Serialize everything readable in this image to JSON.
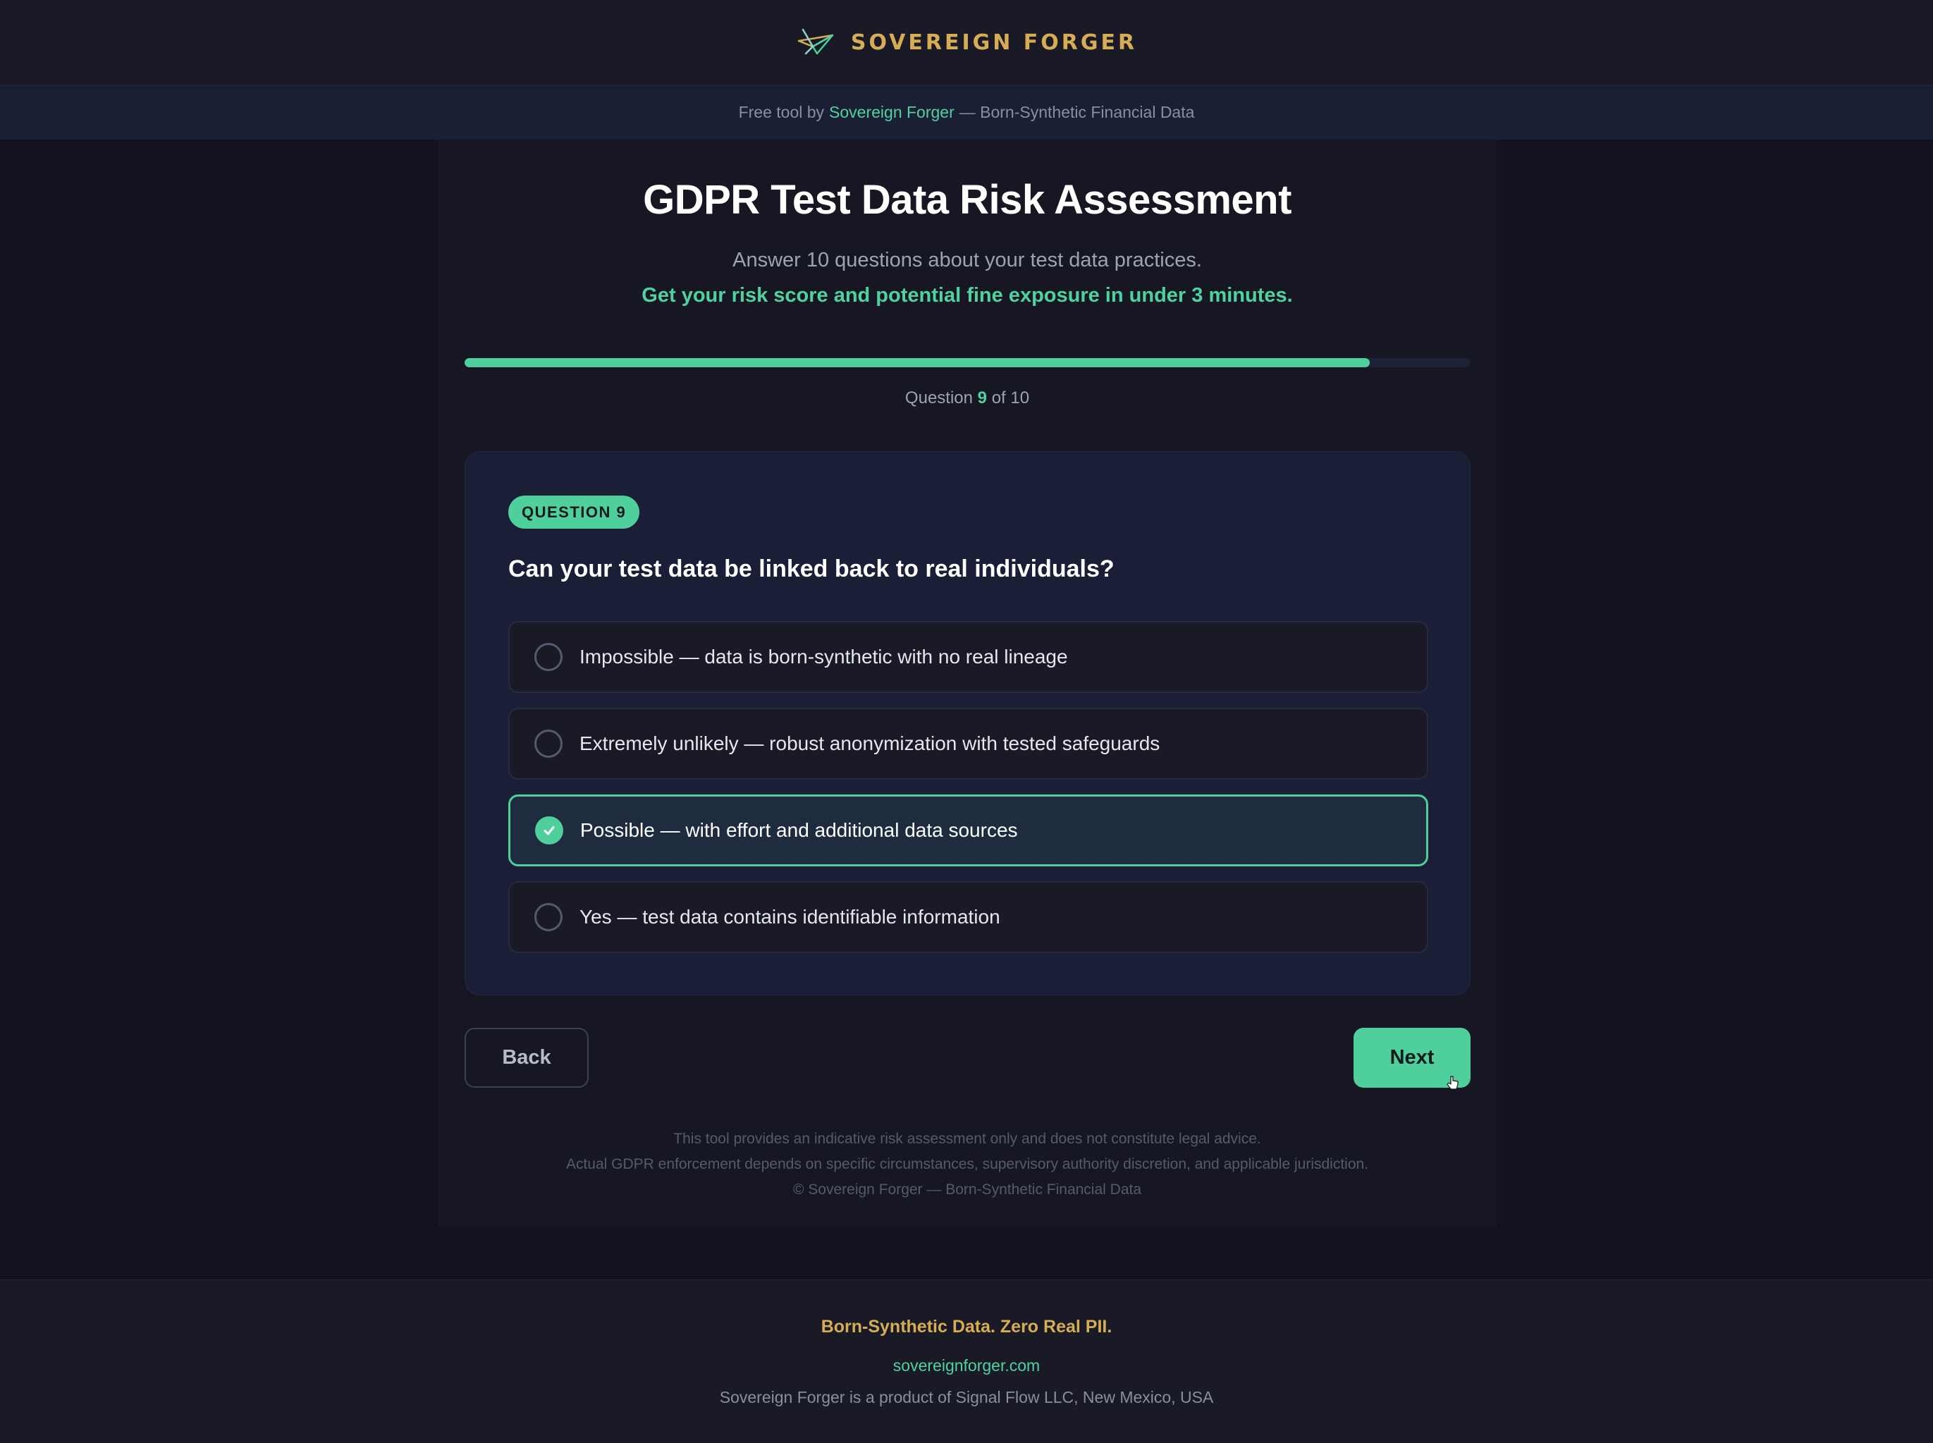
{
  "header": {
    "brand_name": "SOVEREIGN FORGER",
    "logo_icon": "paper-plane-logo-icon"
  },
  "subbar": {
    "prefix": "Free tool by",
    "link": "Sovereign Forger",
    "suffix": "— Born-Synthetic Financial Data"
  },
  "main": {
    "title": "GDPR Test Data Risk Assessment",
    "subtitle": "Answer 10 questions about your test data practices.",
    "subtitle_highlight": "Get your risk score and potential fine exposure in under 3 minutes.",
    "progress": {
      "current": "9",
      "total": "10",
      "fraction": 0.9,
      "prefix": "Question",
      "of": "of"
    },
    "question": {
      "badge": "QUESTION 9",
      "text": "Can your test data be linked back to real individuals?",
      "options": [
        {
          "label": "Impossible — data is born-synthetic with no real lineage",
          "selected": false
        },
        {
          "label": "Extremely unlikely — robust anonymization with tested safeguards",
          "selected": false
        },
        {
          "label": "Possible — with effort and additional data sources",
          "selected": true
        },
        {
          "label": "Yes — test data contains identifiable information",
          "selected": false
        }
      ]
    },
    "buttons": {
      "back": "Back",
      "next": "Next"
    },
    "disclaimer": [
      "This tool provides an indicative risk assessment only and does not constitute legal advice.",
      "Actual GDPR enforcement depends on specific circumstances, supervisory authority discretion, and applicable jurisdiction.",
      "© Sovereign Forger — Born-Synthetic Financial Data"
    ]
  },
  "footer": {
    "tagline": "Born-Synthetic Data. Zero Real PII.",
    "url": "sovereignforger.com",
    "note": "Sovereign Forger is a product of Signal Flow LLC, New Mexico, USA"
  },
  "colors": {
    "accent": "#4fcf9c",
    "gold": "#d6ad55",
    "background": "#12121f",
    "card": "#1a1e37"
  }
}
